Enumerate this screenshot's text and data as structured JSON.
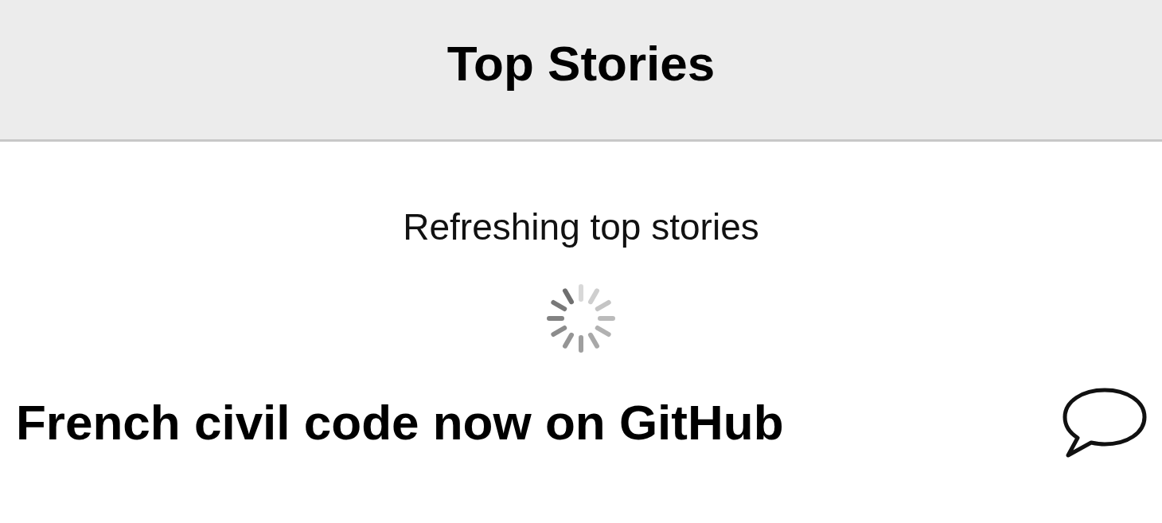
{
  "header": {
    "title": "Top Stories"
  },
  "refresh": {
    "message": "Refreshing top stories"
  },
  "stories": [
    {
      "title": "French civil code now on GitHub"
    }
  ]
}
